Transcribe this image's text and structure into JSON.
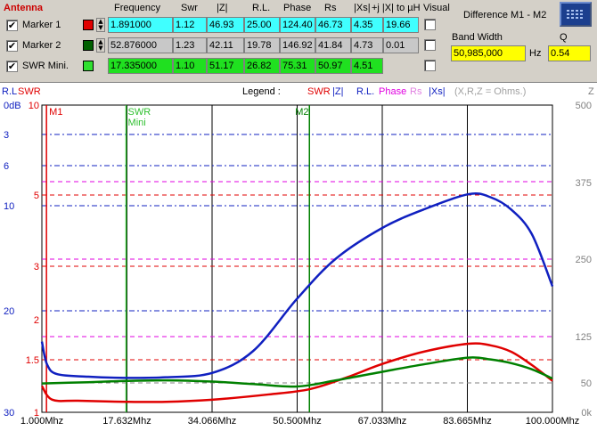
{
  "header": {
    "antenna": "Antenna",
    "frequency": "Frequency",
    "swr": "Swr",
    "z": "|Z|",
    "rl": "R.L.",
    "phase": "Phase",
    "rs": "Rs",
    "xs": "|Xs|",
    "to_uh": "+j  |X| to µH",
    "visual": "Visual"
  },
  "rows": [
    {
      "label": "Marker 1",
      "checked": "✔",
      "color": "#e00000",
      "bg": "#40ffff",
      "frequency": "1.891000",
      "swr": "1.12",
      "z": "46.93",
      "rl": "25.00",
      "phase": "124.40",
      "rs": "46.73",
      "xs": "4.35",
      "uh": "19.66"
    },
    {
      "label": "Marker 2",
      "checked": "✔",
      "color": "#006000",
      "bg": "#c8c8c8",
      "frequency": "52.876000",
      "swr": "1.23",
      "z": "42.11",
      "rl": "19.78",
      "phase": "146.92",
      "rs": "41.84",
      "xs": "4.73",
      "uh": "0.01"
    },
    {
      "label": "SWR Mini.",
      "checked": "✔",
      "color": "#30e030",
      "bg": "#20e020",
      "frequency": "17.335000",
      "swr": "1.10",
      "z": "51.17",
      "rl": "26.82",
      "phase": "75.31",
      "rs": "50.97",
      "xs": "4.51",
      "uh": ""
    }
  ],
  "difference": {
    "title": "Difference M1 - M2",
    "bandwidth_label": "Band Width",
    "bandwidth_value": "50,985,000",
    "hz": "Hz",
    "q_label": "Q",
    "q_value": "0.54",
    "calc_icon": "calculator-icon"
  },
  "legend": {
    "left_axis_title_rl": "R.L",
    "left_axis_title_swr": "SWR",
    "right_axis_title": "Z",
    "legend_label": "Legend :",
    "swr": "SWR",
    "z": "|Z|",
    "rl": "R.L.",
    "phase": "Phase",
    "rs": "Rs",
    "xs": "|Xs|",
    "units": "(X,R,Z = Ohms.)",
    "sep": "|"
  },
  "colors": {
    "swr": "#e00000",
    "z": "#1020c0",
    "rl": "#1020c0",
    "phase": "#e000e0",
    "rs": "#e080e0",
    "xs": "#1020c0",
    "marker1": "#e00000",
    "marker2": "#008000",
    "swr_mini": "#30c030"
  },
  "markers": {
    "m1": {
      "label": "M1",
      "freq": 1.891
    },
    "m2": {
      "label": "M2",
      "freq": 52.876
    },
    "swr_mini": {
      "label_line1": "SWR",
      "label_line2": "Mini",
      "freq": 17.335
    }
  },
  "chart_data": {
    "type": "line",
    "x_ticks": [
      "1.000Mhz",
      "17.632Mhz",
      "34.066Mhz",
      "50.500Mhz",
      "67.033Mhz",
      "83.665Mhz",
      "100.000Mhz"
    ],
    "xlim": [
      1,
      100
    ],
    "left_rl_ticks": [
      "0dB",
      "3",
      "6",
      "10",
      "20",
      "30"
    ],
    "left_swr_ticks": [
      "10",
      "5",
      "3",
      "2",
      "1.5",
      "1"
    ],
    "right_z_ticks": [
      "500",
      "375",
      "250",
      "125",
      "50",
      "0k"
    ],
    "z_ylim": [
      0,
      500
    ],
    "series": [
      {
        "name": "SWR",
        "x": [
          1,
          3,
          8,
          17.3,
          25,
          34,
          45,
          52.9,
          60,
          67,
          75,
          83.7,
          88,
          92,
          96,
          100
        ],
        "y": [
          1.25,
          1.12,
          1.11,
          1.1,
          1.1,
          1.12,
          1.17,
          1.22,
          1.33,
          1.46,
          1.6,
          1.7,
          1.68,
          1.6,
          1.45,
          1.3
        ]
      },
      {
        "name": "|Z|",
        "x": [
          1,
          2,
          4,
          10,
          17.3,
          25,
          34,
          42,
          50.5,
          58,
          67,
          75,
          83.7,
          88,
          92,
          96,
          100
        ],
        "y": [
          115,
          78,
          62,
          58,
          56,
          57,
          64,
          100,
          185,
          250,
          300,
          330,
          355,
          350,
          330,
          290,
          205
        ]
      },
      {
        "name": "Rs",
        "x": [
          1,
          10,
          17.3,
          25,
          34,
          42,
          50.5,
          58,
          67,
          75,
          83.7,
          88,
          92,
          96,
          100
        ],
        "y": [
          47,
          49,
          51,
          52,
          50,
          46,
          42,
          52,
          66,
          78,
          89,
          86,
          80,
          70,
          55
        ]
      }
    ]
  }
}
